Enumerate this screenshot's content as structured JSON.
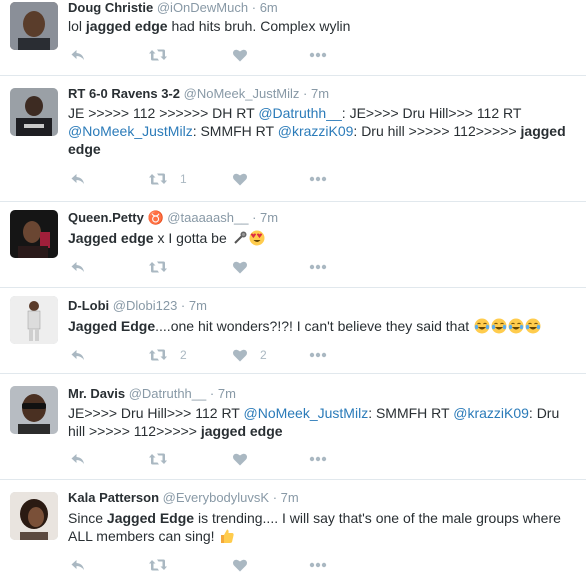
{
  "tweets": [
    {
      "name": "Doug Christie",
      "handle": "@iOnDewMuch",
      "sep": "·",
      "time": "6m",
      "text": {
        "p1": "lol ",
        "b1": "jagged edge",
        "p2": " had hits bruh. Complex wylin"
      },
      "actions": {
        "retweet_count": "",
        "like_count": ""
      }
    },
    {
      "name": "RT 6-0 Ravens 3-2",
      "handle": "@NoMeek_JustMilz",
      "sep": "·",
      "time": "7m",
      "text": {
        "p1": "JE >>>>> 112 >>>>>> DH  RT ",
        "m1": "@Datruthh__",
        "p2": ": JE>>>> Dru Hill>>> 112 RT ",
        "m2": "@NoMeek_JustMilz",
        "p3": ": SMMFH RT ",
        "m3": "@krazziK09",
        "p4": ": Dru hill >>>>> 112>>>>> ",
        "b1": "jagged edge"
      },
      "actions": {
        "retweet_count": "1",
        "like_count": ""
      }
    },
    {
      "name": "Queen.Petty",
      "name_symbol": "♉",
      "handle": "@taaaaash__",
      "sep": "·",
      "time": "7m",
      "text": {
        "b1": "Jagged edge",
        "p1": " x I gotta be "
      },
      "actions": {
        "retweet_count": "",
        "like_count": ""
      }
    },
    {
      "name": "D-Lobi",
      "handle": "@Dlobi123",
      "sep": "·",
      "time": "7m",
      "text": {
        "b1": "Jagged Edge",
        "p1": "....one hit wonders?!?! I can't believe they said that "
      },
      "actions": {
        "retweet_count": "2",
        "like_count": "2"
      }
    },
    {
      "name": "Mr. Davis",
      "handle": "@Datruthh__",
      "sep": "·",
      "time": "7m",
      "text": {
        "p1": "JE>>>> Dru Hill>>> 112 RT ",
        "m1": "@NoMeek_JustMilz",
        "p2": ": SMMFH RT ",
        "m2": "@krazziK09",
        "p3": ": Dru hill >>>>> 112>>>>> ",
        "b1": "jagged edge"
      },
      "actions": {
        "retweet_count": "",
        "like_count": ""
      }
    },
    {
      "name": "Kala Patterson",
      "handle": "@EverybodyluvsK",
      "sep": "·",
      "time": "7m",
      "text": {
        "p1": "Since ",
        "b1": "Jagged Edge",
        "p2": " is trending.... I will say that's one of the male groups where ALL members can sing! "
      },
      "actions": {
        "retweet_count": "",
        "like_count": ""
      }
    }
  ],
  "icons": {
    "reply": "reply-arrow-icon",
    "retweet": "retweet-icon",
    "like": "heart-icon",
    "more": "more-dots-icon"
  },
  "colors": {
    "text": "#292f33",
    "muted": "#8899a6",
    "link": "#2b7bb9",
    "icon": "#aab8c2",
    "divider": "#e1e8ed"
  }
}
